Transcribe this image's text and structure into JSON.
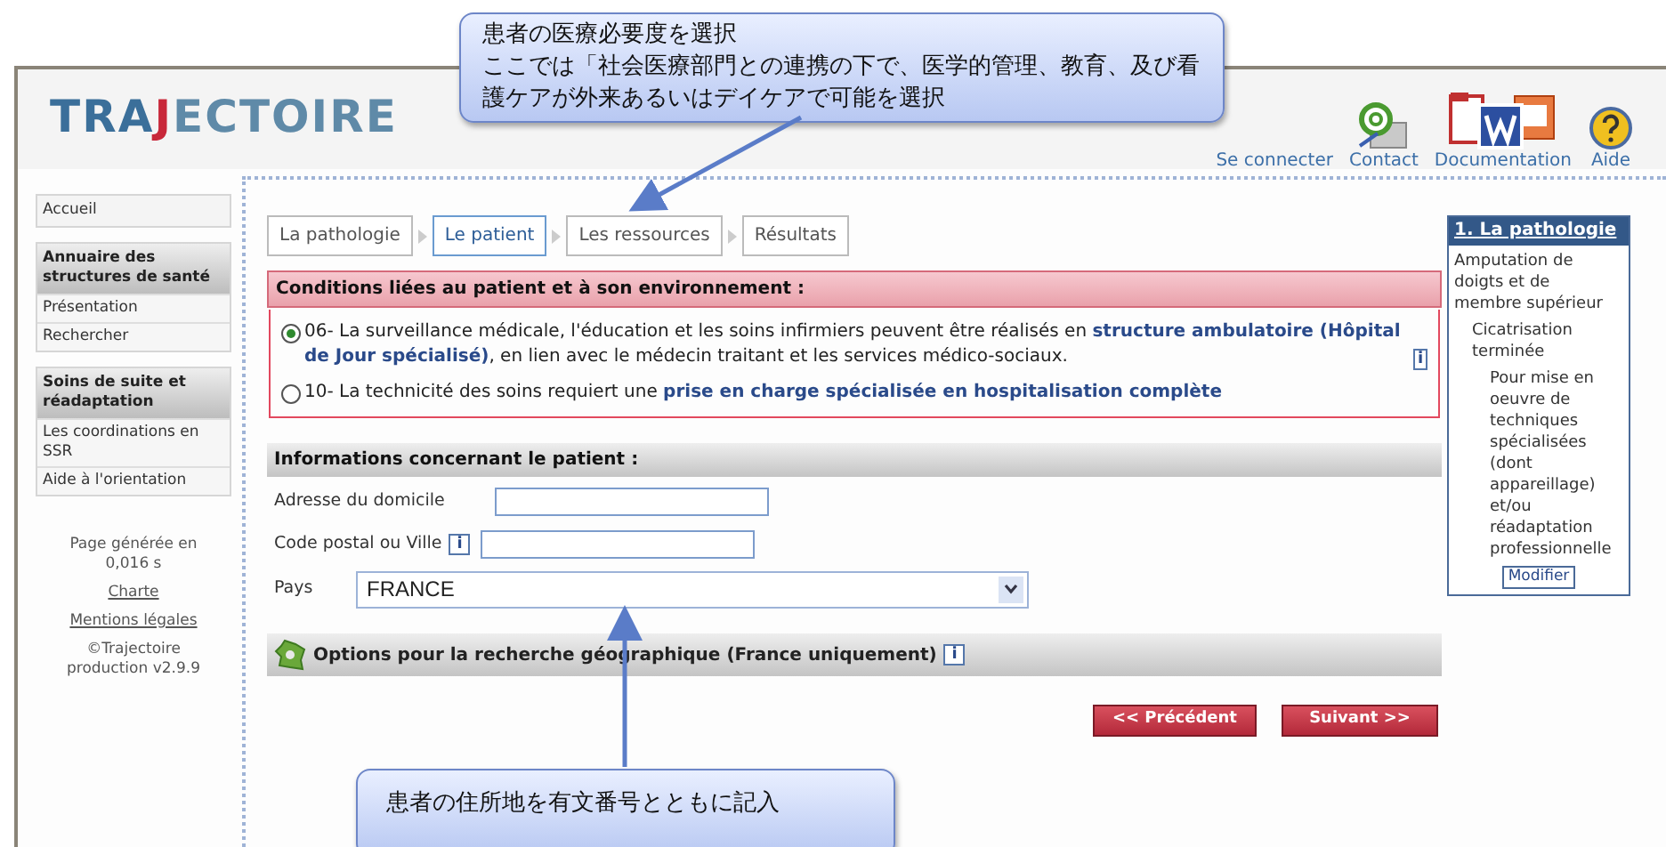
{
  "callouts": [
    {
      "kind": "top",
      "title": "患者の医療必要度を選択",
      "text": "ここでは「社会医療部門との連携の下で、医学的管理、教育、及び看護ケアが外来あるいはデイケアで可能を選択"
    },
    {
      "kind": "bottom",
      "text": "患者の住所地を有文番号とともに記入"
    }
  ],
  "header": {
    "logo": "TRAJECTOIRE",
    "links": [
      {
        "kind": "login",
        "label": "Se connecter"
      },
      {
        "kind": "contact",
        "label": "Contact"
      },
      {
        "kind": "docs",
        "label": "Documentation"
      },
      {
        "kind": "help",
        "label": "Aide"
      }
    ]
  },
  "sidebar": {
    "sections": [
      {
        "title": "Accueil"
      },
      {
        "title": "Annuaire des structures de santé",
        "items": [
          "Présentation",
          "Rechercher"
        ]
      },
      {
        "title": "Soins de suite et réadaptation",
        "items": [
          "Les coordinations en SSR",
          "Aide à l'orientation"
        ]
      }
    ],
    "footer": {
      "generated": "Page générée en 0,016 s",
      "links": [
        "Charte",
        "Mentions légales"
      ],
      "copyright": "©Trajectoire production v2.9.9"
    }
  },
  "steps": [
    {
      "label": "La pathologie",
      "selected": false
    },
    {
      "label": "Le patient",
      "selected": true
    },
    {
      "label": "Les ressources",
      "selected": false
    },
    {
      "label": "Résultats",
      "selected": false
    }
  ],
  "conditions": {
    "title": "Conditions liées au patient et à son environnement :",
    "options": [
      {
        "text": "06- La surveillance médicale, l'éducation et les soins infirmiers peuvent être réalisés en **structure ambulatoire (Hôpital de Jour spécialisé)**, en lien avec le médecin traitant et les services médico-sociaux.",
        "info": "i",
        "selected": true
      },
      {
        "text": "10- La technicité des soins requiert une **prise en charge spécialisée en hospitalisation complète**",
        "selected": false
      }
    ]
  },
  "patient_info": {
    "title": "Informations concernant le patient :",
    "fields": [
      {
        "kind": "text",
        "label": "Adresse du domicile"
      },
      {
        "kind": "text",
        "label": "Code postal ou Ville",
        "info": "i"
      },
      {
        "kind": "select",
        "label": "Pays",
        "value": "FRANCE"
      }
    ]
  },
  "geo_options": {
    "title": "Options pour la recherche géographique (France uniquement)",
    "info": "i"
  },
  "buttons": [
    {
      "label": "<< Précédent"
    },
    {
      "label": "Suivant >>"
    }
  ],
  "summary": {
    "title": "1. La pathologie",
    "tree": [
      {
        "label": "Amputation de doigts et de membre supérieur",
        "children": [
          {
            "label": "Cicatrisation terminée",
            "children": [
              {
                "label": "Pour mise en oeuvre de techniques spécialisées (dont appareillage) et/ou réadaptation professionnelle"
              }
            ]
          }
        ]
      }
    ],
    "button": "Modifier"
  }
}
